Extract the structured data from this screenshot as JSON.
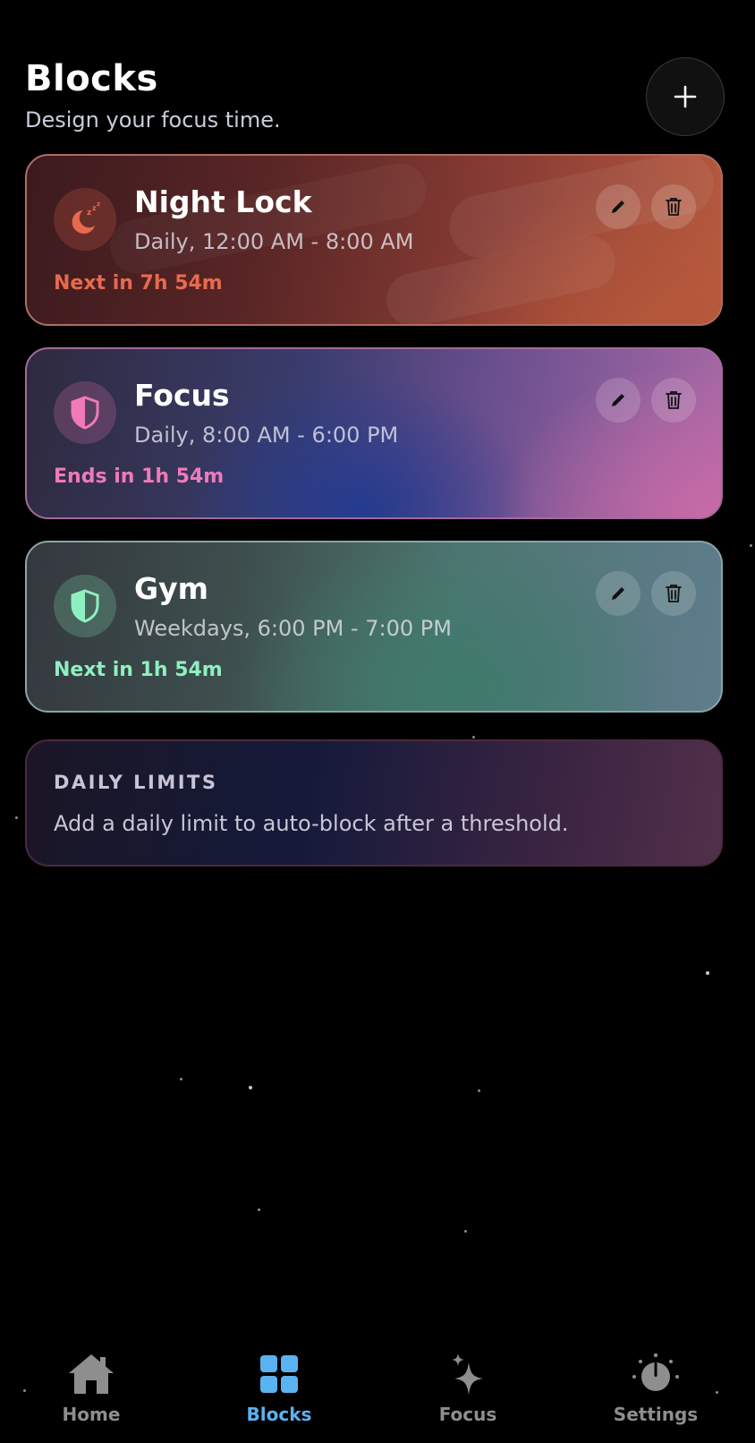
{
  "header": {
    "title": "Blocks",
    "subtitle": "Design your focus time."
  },
  "blocks": [
    {
      "name": "Night Lock",
      "schedule": "Daily, 12:00 AM - 8:00 AM",
      "status": "Next in 7h 54m",
      "icon": "moon-sleep-icon",
      "accent": "#e86a4e"
    },
    {
      "name": "Focus",
      "schedule": "Daily, 8:00 AM - 6:00 PM",
      "status": "Ends in 1h 54m",
      "icon": "shield-icon",
      "accent": "#f07ab8"
    },
    {
      "name": "Gym",
      "schedule": "Weekdays, 6:00 PM - 7:00 PM",
      "status": "Next in 1h 54m",
      "icon": "shield-icon",
      "accent": "#8ef0c0"
    }
  ],
  "daily_limits": {
    "heading": "DAILY LIMITS",
    "text": "Add a daily limit to auto-block after a threshold."
  },
  "nav": {
    "items": [
      {
        "label": "Home",
        "icon": "home-icon"
      },
      {
        "label": "Blocks",
        "icon": "grid-icon",
        "active": true
      },
      {
        "label": "Focus",
        "icon": "sparkle-icon"
      },
      {
        "label": "Settings",
        "icon": "gauge-icon"
      }
    ],
    "active_color": "#5bb2f0",
    "inactive_color": "#8e8e8e"
  }
}
